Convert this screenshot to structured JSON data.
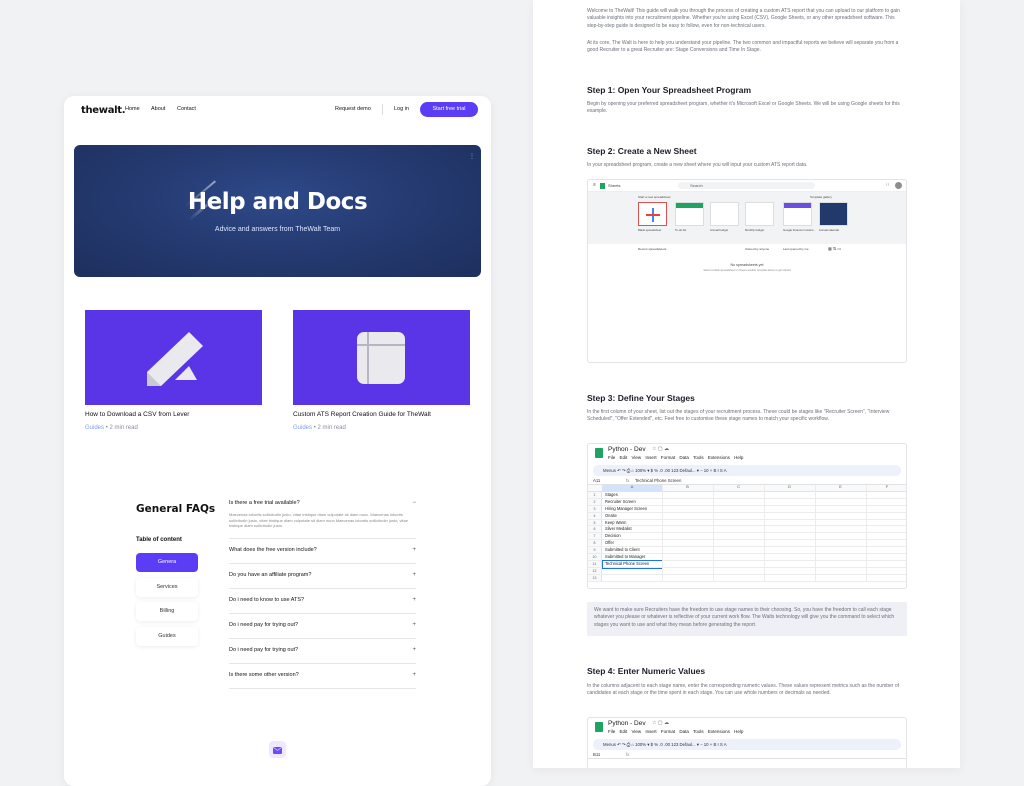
{
  "site": {
    "logo": "thewalt.",
    "nav": {
      "home": "Home",
      "about": "About",
      "contact": "Contact",
      "request_demo": "Request demo",
      "login": "Log in",
      "trial": "Start free trial"
    },
    "hero": {
      "title": "Help and Docs",
      "subtitle": "Advice and answers from TheWalt Team"
    },
    "guides": [
      {
        "title": "How to Download a CSV from Lever",
        "tag": "Guides",
        "read": "2 min read",
        "icon": "pencil-icon"
      },
      {
        "title": "Custom ATS Report Creation Guide for TheWalt",
        "tag": "Guides",
        "read": "2 min read",
        "icon": "grid-icon"
      }
    ],
    "faq": {
      "title": "General FAQs",
      "toc_label": "Table of content",
      "toc": [
        "Genera",
        "Services",
        "Billing",
        "Guides"
      ],
      "items": [
        {
          "q": "Is there a free trial available?",
          "sign": "−",
          "a": "Maecenas lobortis sollicitudin justo, vitae tristique diam vulputate sit diam nunc. Maecenas lobortis sollicitudin justo, vitae tristique diam vulputate sit diam nunc Maecenas lobortis sollicitudin justo, vitae tristique diam sollicitudin justo."
        },
        {
          "q": "What does the free version include?",
          "sign": "+"
        },
        {
          "q": "Do you have an affiliate program?",
          "sign": "+"
        },
        {
          "q": "Do i need to know to use ATS?",
          "sign": "+"
        },
        {
          "q": "Do i need pay for trying out?",
          "sign": "+"
        },
        {
          "q": "Do i need pay for trying out?",
          "sign": "+"
        },
        {
          "q": "Is there some other version?",
          "sign": "+"
        }
      ]
    }
  },
  "doc": {
    "intro1": "Welcome to TheWalt! This guide will walk you through the process of creating a custom ATS report that you can upload to our platform to gain valuable insights into your recruitment pipeline. Whether you're using Excel (CSV), Google Sheets, or any other spreadsheet software. This step-by-step guide is designed to be easy to follow, even for non-technical users.",
    "intro2": "At its core, The Walt is here to help you understand your pipeline. The two common and impactful reports we believe will separate you from a good Recruiter to a great Recruiter are: Stage Conversions and Time In Stage.",
    "step1": {
      "h": "Step 1: Open Your Spreadsheet Program",
      "p": "Begin by opening your preferred spreadsheet program, whether it's Microsoft Excel or Google Sheets. We will be using Google sheets for this example."
    },
    "step2": {
      "h": "Step 2: Create a New Sheet",
      "p": "In your spreadsheet program, create a new sheet where you will input your custom ATS report data."
    },
    "step3": {
      "h": "Step 3: Define Your Stages",
      "p": "In the first column of your sheet, list out the stages of your recruitment process. These could be stages like \"Recruiter Screen\", \"Interview Scheduled\", \"Offer Extended\", etc. Feel free to customise these stage names to match your specific workflow."
    },
    "note": "We want to make sure Recruiters have the freedom to use stage names to their choosing. So, you have the freedom to call each stage whatever you please or whatever is reflective of your current work flow. The Walts technology will give you the command to select which stages you want to use and what they mean before generating the report.",
    "step4": {
      "h": "Step 4: Enter Numeric Values",
      "p": "In the columns adjacent to each stage name, enter the corresponding numeric values. These values represent metrics such as the number of candidates at each stage or the time spent in each stage. You can use whole numbers or decimals as needed."
    },
    "sheets_home": {
      "app": "Sheets",
      "search": "Search",
      "start": "Start a new spreadsheet",
      "gallery": "Template gallery",
      "templates": [
        "Blank spreadsheet",
        "To-do list",
        "Annual budget",
        "Monthly budget",
        "Google Finance Investm...",
        "Annual calendar"
      ],
      "recent": "Recent spreadsheets",
      "owned": "Owned by anyone",
      "opened": "Last opened by me",
      "empty": "No spreadsheets yet",
      "empty_sub": "Select a blank spreadsheet or choose another template above to get started"
    },
    "sheet": {
      "title": "Python - Dev",
      "menu": "File Edit View Insert Format Data Tools Extensions Help",
      "toolbar": "Menus   ↶  ↷  ⎙  ⌂  100% ▾   $  %  .0  .00  123   Defaul... ▾   −  10  +   B  I  S  A",
      "cellref": "A11",
      "formula": "Technical Phone Screen",
      "cols": [
        "A",
        "B",
        "C",
        "D",
        "E",
        "F"
      ],
      "rows": [
        "Stages",
        "Recruiter Screen",
        "Hiring Manager Screen",
        "Onsite",
        "Keep Warm",
        "Silver Medalist",
        "Decision",
        "Offer",
        "Submitted to Client",
        "Submitted to Manager",
        "Technical Phone Screen",
        "",
        ""
      ],
      "cellref2": "B11"
    }
  }
}
